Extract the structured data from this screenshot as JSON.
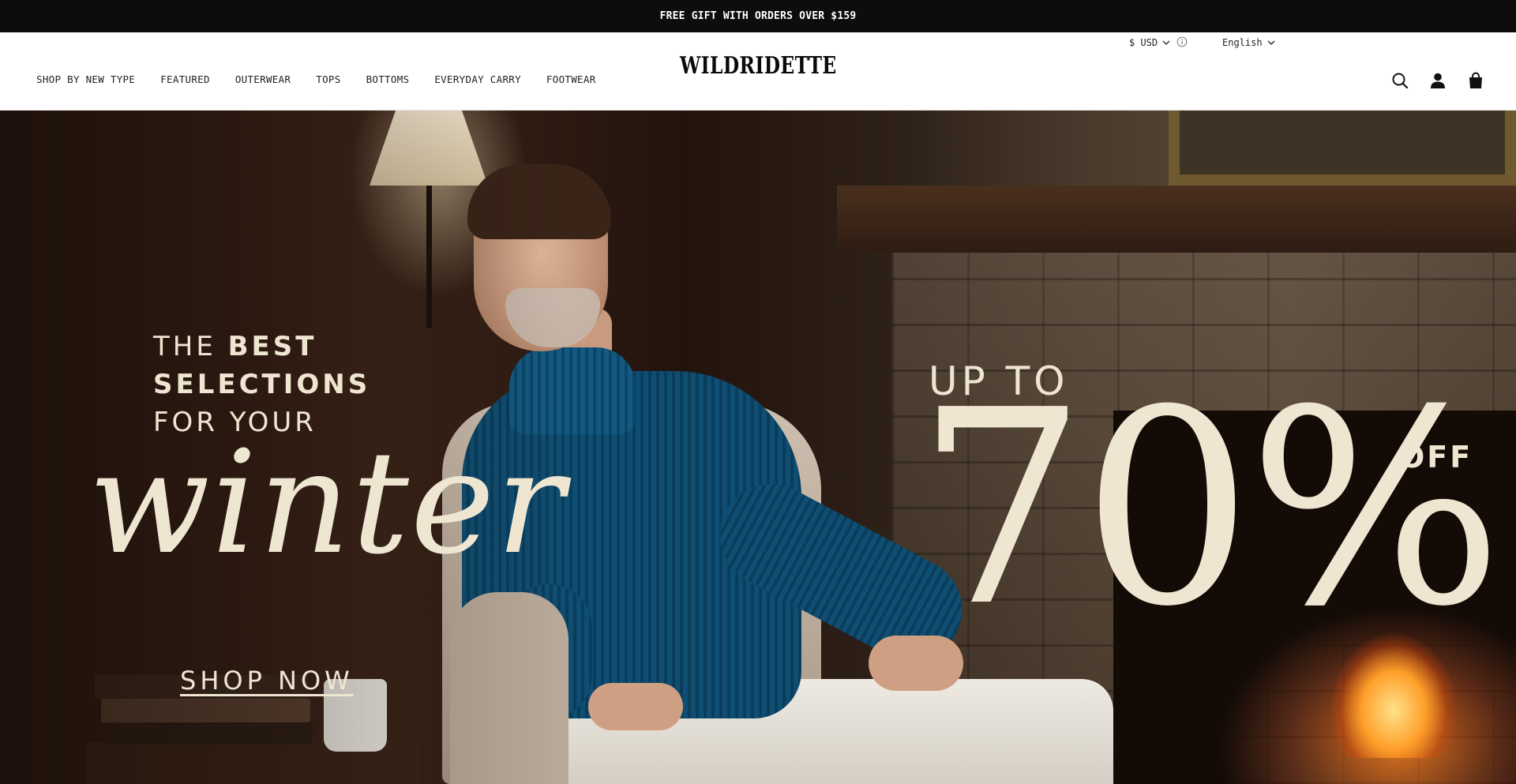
{
  "announcement": {
    "text": "FREE GIFT WITH ORDERS OVER $159"
  },
  "utility": {
    "currency": "$ USD",
    "language": "English"
  },
  "nav": {
    "items": [
      {
        "label": "SHOP BY NEW TYPE"
      },
      {
        "label": "FEATURED"
      },
      {
        "label": "OUTERWEAR"
      },
      {
        "label": "TOPS"
      },
      {
        "label": "BOTTOMS"
      },
      {
        "label": "EVERYDAY CARRY"
      },
      {
        "label": "FOOTWEAR"
      }
    ]
  },
  "brand": {
    "logo_text": "WILDRIDETTE"
  },
  "header_icons": [
    "search-icon",
    "account-icon",
    "cart-icon"
  ],
  "hero": {
    "line1_light": "THE ",
    "line1_bold": "BEST",
    "line2": "SELECTIONS",
    "line3": "FOR YOUR",
    "script": "winter",
    "cta": "SHOP NOW",
    "up_to": "UP TO",
    "percent": "70%",
    "off": "OFF"
  },
  "colors": {
    "announcement_bg": "#0d0d0d",
    "header_bg": "#ffffff",
    "hero_text": "#efe6d2",
    "sweater": "#0f4e73"
  }
}
